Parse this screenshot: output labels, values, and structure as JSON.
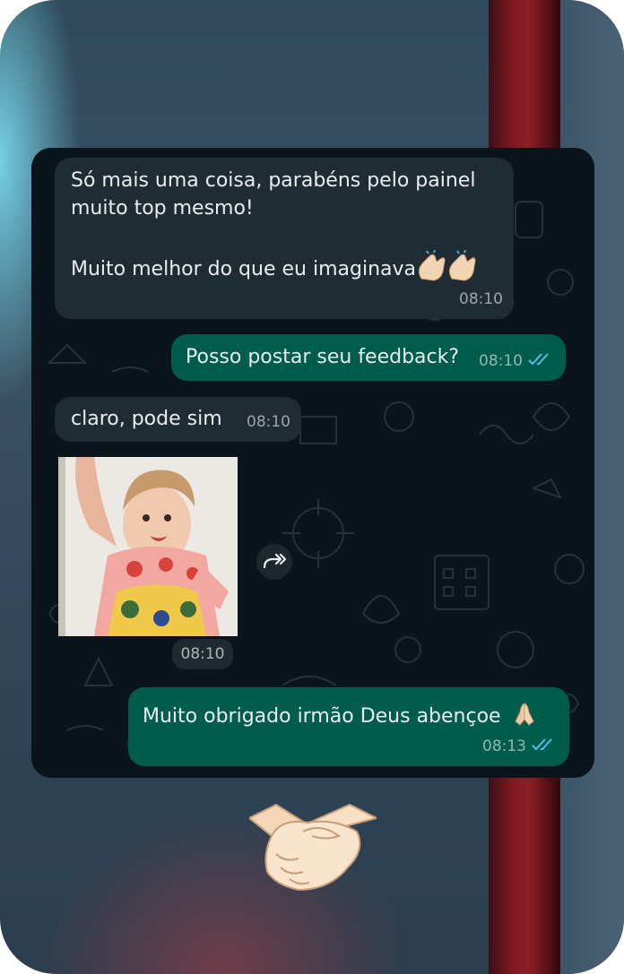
{
  "messages": [
    {
      "direction": "incoming",
      "text": "Só mais uma coisa, parabéns pelo painel\nmuito top mesmo!\n\nMuito melhor do que eu imaginava",
      "emoji": "clapping-hands-icon",
      "time": "08:10"
    },
    {
      "direction": "outgoing",
      "text": "Posso postar seu feedback?",
      "time": "08:10",
      "status": "read"
    },
    {
      "direction": "incoming",
      "text": "claro, pode sim",
      "time": "08:10"
    },
    {
      "direction": "incoming",
      "type": "sticker",
      "time": "08:10"
    },
    {
      "direction": "outgoing",
      "text": "Muito obrigado irmão Deus abençoe",
      "emoji": "folded-hands-icon",
      "time": "08:13",
      "status": "read"
    }
  ],
  "icons": {
    "read_receipt": "double-check-icon",
    "forward": "forward-icon",
    "footer": "handshake-icon"
  },
  "colors": {
    "chat_background": "#0b141a",
    "incoming_bubble": "#202c33",
    "outgoing_bubble": "#005c4b",
    "read_tick": "#53bdeb"
  }
}
